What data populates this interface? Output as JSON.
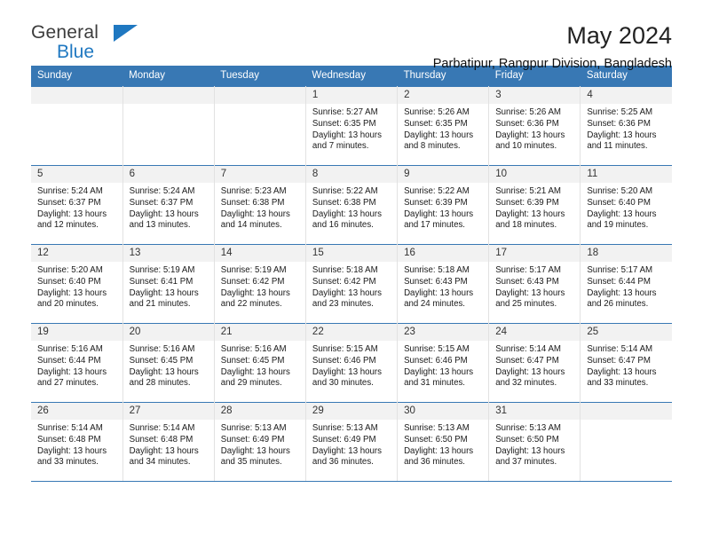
{
  "brand": {
    "name_top": "General",
    "name_bottom": "Blue",
    "triangle_icon": "triangle-icon",
    "accent_color": "#1f78c1",
    "text_color": "#3c3c3c"
  },
  "header": {
    "title": "May 2024",
    "subtitle": "Parbatipur, Rangpur Division, Bangladesh"
  },
  "calendar": {
    "header_bg": "#3878b4",
    "header_text_color": "#ffffff",
    "daynum_bg": "#f2f2f2",
    "weekday_labels": [
      "Sunday",
      "Monday",
      "Tuesday",
      "Wednesday",
      "Thursday",
      "Friday",
      "Saturday"
    ],
    "labels": {
      "sunrise": "Sunrise:",
      "sunset": "Sunset:",
      "daylight": "Daylight:"
    },
    "weeks": [
      [
        {
          "day": "",
          "empty": true
        },
        {
          "day": "",
          "empty": true
        },
        {
          "day": "",
          "empty": true
        },
        {
          "day": "1",
          "sunrise": "Sunrise: 5:27 AM",
          "sunset": "Sunset: 6:35 PM",
          "daylight": "Daylight: 13 hours and 7 minutes."
        },
        {
          "day": "2",
          "sunrise": "Sunrise: 5:26 AM",
          "sunset": "Sunset: 6:35 PM",
          "daylight": "Daylight: 13 hours and 8 minutes."
        },
        {
          "day": "3",
          "sunrise": "Sunrise: 5:26 AM",
          "sunset": "Sunset: 6:36 PM",
          "daylight": "Daylight: 13 hours and 10 minutes."
        },
        {
          "day": "4",
          "sunrise": "Sunrise: 5:25 AM",
          "sunset": "Sunset: 6:36 PM",
          "daylight": "Daylight: 13 hours and 11 minutes."
        }
      ],
      [
        {
          "day": "5",
          "sunrise": "Sunrise: 5:24 AM",
          "sunset": "Sunset: 6:37 PM",
          "daylight": "Daylight: 13 hours and 12 minutes."
        },
        {
          "day": "6",
          "sunrise": "Sunrise: 5:24 AM",
          "sunset": "Sunset: 6:37 PM",
          "daylight": "Daylight: 13 hours and 13 minutes."
        },
        {
          "day": "7",
          "sunrise": "Sunrise: 5:23 AM",
          "sunset": "Sunset: 6:38 PM",
          "daylight": "Daylight: 13 hours and 14 minutes."
        },
        {
          "day": "8",
          "sunrise": "Sunrise: 5:22 AM",
          "sunset": "Sunset: 6:38 PM",
          "daylight": "Daylight: 13 hours and 16 minutes."
        },
        {
          "day": "9",
          "sunrise": "Sunrise: 5:22 AM",
          "sunset": "Sunset: 6:39 PM",
          "daylight": "Daylight: 13 hours and 17 minutes."
        },
        {
          "day": "10",
          "sunrise": "Sunrise: 5:21 AM",
          "sunset": "Sunset: 6:39 PM",
          "daylight": "Daylight: 13 hours and 18 minutes."
        },
        {
          "day": "11",
          "sunrise": "Sunrise: 5:20 AM",
          "sunset": "Sunset: 6:40 PM",
          "daylight": "Daylight: 13 hours and 19 minutes."
        }
      ],
      [
        {
          "day": "12",
          "sunrise": "Sunrise: 5:20 AM",
          "sunset": "Sunset: 6:40 PM",
          "daylight": "Daylight: 13 hours and 20 minutes."
        },
        {
          "day": "13",
          "sunrise": "Sunrise: 5:19 AM",
          "sunset": "Sunset: 6:41 PM",
          "daylight": "Daylight: 13 hours and 21 minutes."
        },
        {
          "day": "14",
          "sunrise": "Sunrise: 5:19 AM",
          "sunset": "Sunset: 6:42 PM",
          "daylight": "Daylight: 13 hours and 22 minutes."
        },
        {
          "day": "15",
          "sunrise": "Sunrise: 5:18 AM",
          "sunset": "Sunset: 6:42 PM",
          "daylight": "Daylight: 13 hours and 23 minutes."
        },
        {
          "day": "16",
          "sunrise": "Sunrise: 5:18 AM",
          "sunset": "Sunset: 6:43 PM",
          "daylight": "Daylight: 13 hours and 24 minutes."
        },
        {
          "day": "17",
          "sunrise": "Sunrise: 5:17 AM",
          "sunset": "Sunset: 6:43 PM",
          "daylight": "Daylight: 13 hours and 25 minutes."
        },
        {
          "day": "18",
          "sunrise": "Sunrise: 5:17 AM",
          "sunset": "Sunset: 6:44 PM",
          "daylight": "Daylight: 13 hours and 26 minutes."
        }
      ],
      [
        {
          "day": "19",
          "sunrise": "Sunrise: 5:16 AM",
          "sunset": "Sunset: 6:44 PM",
          "daylight": "Daylight: 13 hours and 27 minutes."
        },
        {
          "day": "20",
          "sunrise": "Sunrise: 5:16 AM",
          "sunset": "Sunset: 6:45 PM",
          "daylight": "Daylight: 13 hours and 28 minutes."
        },
        {
          "day": "21",
          "sunrise": "Sunrise: 5:16 AM",
          "sunset": "Sunset: 6:45 PM",
          "daylight": "Daylight: 13 hours and 29 minutes."
        },
        {
          "day": "22",
          "sunrise": "Sunrise: 5:15 AM",
          "sunset": "Sunset: 6:46 PM",
          "daylight": "Daylight: 13 hours and 30 minutes."
        },
        {
          "day": "23",
          "sunrise": "Sunrise: 5:15 AM",
          "sunset": "Sunset: 6:46 PM",
          "daylight": "Daylight: 13 hours and 31 minutes."
        },
        {
          "day": "24",
          "sunrise": "Sunrise: 5:14 AM",
          "sunset": "Sunset: 6:47 PM",
          "daylight": "Daylight: 13 hours and 32 minutes."
        },
        {
          "day": "25",
          "sunrise": "Sunrise: 5:14 AM",
          "sunset": "Sunset: 6:47 PM",
          "daylight": "Daylight: 13 hours and 33 minutes."
        }
      ],
      [
        {
          "day": "26",
          "sunrise": "Sunrise: 5:14 AM",
          "sunset": "Sunset: 6:48 PM",
          "daylight": "Daylight: 13 hours and 33 minutes."
        },
        {
          "day": "27",
          "sunrise": "Sunrise: 5:14 AM",
          "sunset": "Sunset: 6:48 PM",
          "daylight": "Daylight: 13 hours and 34 minutes."
        },
        {
          "day": "28",
          "sunrise": "Sunrise: 5:13 AM",
          "sunset": "Sunset: 6:49 PM",
          "daylight": "Daylight: 13 hours and 35 minutes."
        },
        {
          "day": "29",
          "sunrise": "Sunrise: 5:13 AM",
          "sunset": "Sunset: 6:49 PM",
          "daylight": "Daylight: 13 hours and 36 minutes."
        },
        {
          "day": "30",
          "sunrise": "Sunrise: 5:13 AM",
          "sunset": "Sunset: 6:50 PM",
          "daylight": "Daylight: 13 hours and 36 minutes."
        },
        {
          "day": "31",
          "sunrise": "Sunrise: 5:13 AM",
          "sunset": "Sunset: 6:50 PM",
          "daylight": "Daylight: 13 hours and 37 minutes."
        },
        {
          "day": "",
          "empty": true
        }
      ]
    ]
  }
}
